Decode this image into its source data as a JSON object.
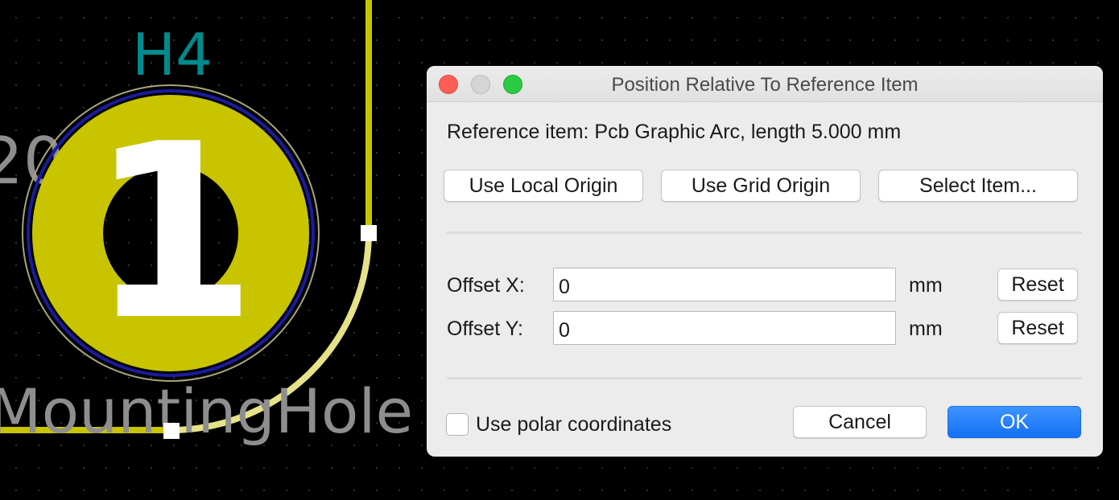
{
  "pcb": {
    "reference_label": "H4",
    "pad_number": "1",
    "value_label": "MountingHole",
    "partial_left_label": "20",
    "colors": {
      "pad": "#c8c400",
      "ref_text": "#008a8c",
      "value_text": "#8e8e8e",
      "courtyard_outline": "#1b1b9c",
      "edge_line": "#c8c400",
      "selected_arc": "#e6e28a",
      "pad_number": "#ffffff",
      "handle": "#ffffff"
    }
  },
  "dialog": {
    "title": "Position Relative To Reference Item",
    "reference_item": "Reference item: Pcb Graphic Arc, length 5.000 mm",
    "buttons": {
      "use_local_origin": "Use Local Origin",
      "use_grid_origin": "Use Grid Origin",
      "select_item": "Select Item...",
      "reset_x": "Reset",
      "reset_y": "Reset",
      "cancel": "Cancel",
      "ok": "OK"
    },
    "offset_x": {
      "label": "Offset X:",
      "value": "0",
      "unit": "mm"
    },
    "offset_y": {
      "label": "Offset Y:",
      "value": "0",
      "unit": "mm"
    },
    "polar_checkbox": {
      "label": "Use polar coordinates",
      "checked": false
    },
    "colors": {
      "background": "#ececec",
      "accent": "#1a73f5"
    }
  }
}
